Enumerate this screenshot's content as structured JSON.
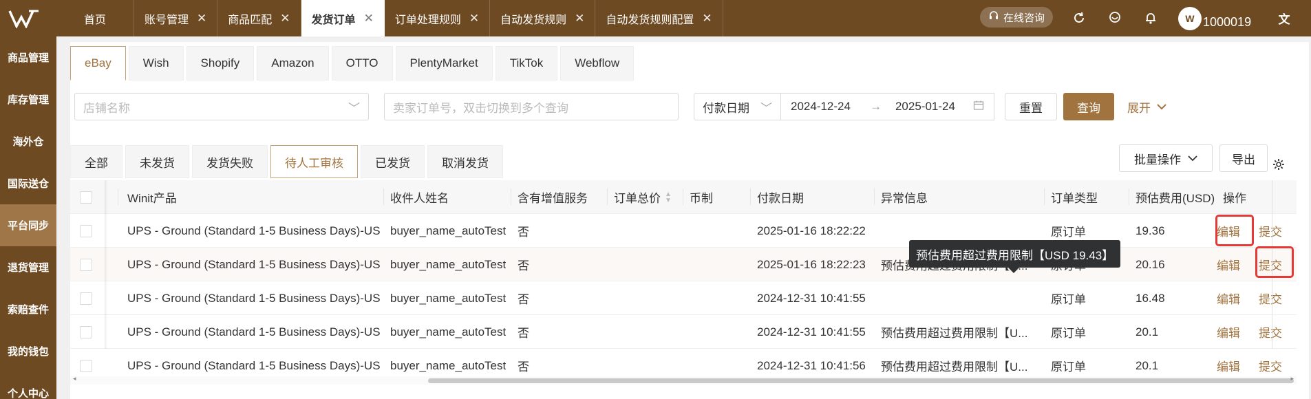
{
  "topbar": {
    "tabs": [
      {
        "label": "首页",
        "closable": false
      },
      {
        "label": "账号管理",
        "closable": true
      },
      {
        "label": "商品匹配",
        "closable": true
      },
      {
        "label": "发货订单",
        "closable": true,
        "active": true
      },
      {
        "label": "订单处理规则",
        "closable": true
      },
      {
        "label": "自动发货规则",
        "closable": true
      },
      {
        "label": "自动发货规则配置",
        "closable": true
      }
    ],
    "consult_label": "在线咨询",
    "user_id": "1000019",
    "avatar_text": "W"
  },
  "sidebar": {
    "items": [
      {
        "label": "商品管理"
      },
      {
        "label": "库存管理"
      },
      {
        "label": "海外仓"
      },
      {
        "label": "国际送仓"
      },
      {
        "label": "平台同步",
        "active": true
      },
      {
        "label": "退货管理"
      },
      {
        "label": "索赔查件"
      },
      {
        "label": "我的钱包"
      },
      {
        "label": "个人中心"
      }
    ]
  },
  "platform_tabs": [
    "eBay",
    "Wish",
    "Shopify",
    "Amazon",
    "OTTO",
    "PlentyMarket",
    "TikTok",
    "Webflow"
  ],
  "filters": {
    "store_placeholder": "店铺名称",
    "order_placeholder": "卖家订单号，双击切换到多个查询",
    "date_type": "付款日期",
    "date_start": "2024-12-24",
    "date_end": "2025-01-24",
    "reset_label": "重置",
    "search_label": "查询",
    "expand_label": "展开"
  },
  "status_tabs": [
    "全部",
    "未发货",
    "发货失败",
    "待人工审核",
    "已发货",
    "取消发货"
  ],
  "toolbar": {
    "batch_label": "批量操作",
    "export_label": "导出"
  },
  "table": {
    "columns": [
      "Winit产品",
      "收件人姓名",
      "含有增值服务",
      "订单总价",
      "币制",
      "付款日期",
      "异常信息",
      "订单类型",
      "预估费用(USD)",
      "操作"
    ],
    "rows": [
      {
        "product": "UPS - Ground (Standard 1-5 Business Days)-US",
        "recipient": "buyer_name_autoTest",
        "vas": "否",
        "total": "",
        "currency": "",
        "pay_date": "2025-01-16 18:22:22",
        "error": "",
        "order_type": "原订单",
        "fee": "19.36",
        "edit": "编辑",
        "submit": "提交"
      },
      {
        "product": "UPS - Ground (Standard 1-5 Business Days)-US",
        "recipient": "buyer_name_autoTest",
        "vas": "否",
        "total": "",
        "currency": "",
        "pay_date": "2025-01-16 18:22:23",
        "error": "预估费用超过费用限制【U...",
        "order_type": "原订单",
        "fee": "20.16",
        "edit": "编辑",
        "submit": "提交"
      },
      {
        "product": "UPS - Ground (Standard 1-5 Business Days)-US",
        "recipient": "buyer_name_autoTest",
        "vas": "否",
        "total": "",
        "currency": "",
        "pay_date": "2024-12-31 10:41:55",
        "error": "",
        "order_type": "原订单",
        "fee": "16.48",
        "edit": "编辑",
        "submit": "提交"
      },
      {
        "product": "UPS - Ground (Standard 1-5 Business Days)-US",
        "recipient": "buyer_name_autoTest",
        "vas": "否",
        "total": "",
        "currency": "",
        "pay_date": "2024-12-31 10:41:55",
        "error": "预估费用超过费用限制【U...",
        "order_type": "原订单",
        "fee": "20.1",
        "edit": "编辑",
        "submit": "提交"
      },
      {
        "product": "UPS - Ground (Standard 1-5 Business Days)-US",
        "recipient": "buyer_name_autoTest",
        "vas": "否",
        "total": "",
        "currency": "",
        "pay_date": "2024-12-31 10:41:56",
        "error": "预估费用超过费用限制【U...",
        "order_type": "原订单",
        "fee": "20.1",
        "edit": "编辑",
        "submit": "提交"
      }
    ]
  },
  "tooltip_text": "预估费用超过费用限制【USD 19.43】",
  "colors": {
    "brand": "#6e4a22",
    "accent": "#a1733f",
    "sidebar_active": "#9e7647",
    "highlight": "#e53935"
  }
}
